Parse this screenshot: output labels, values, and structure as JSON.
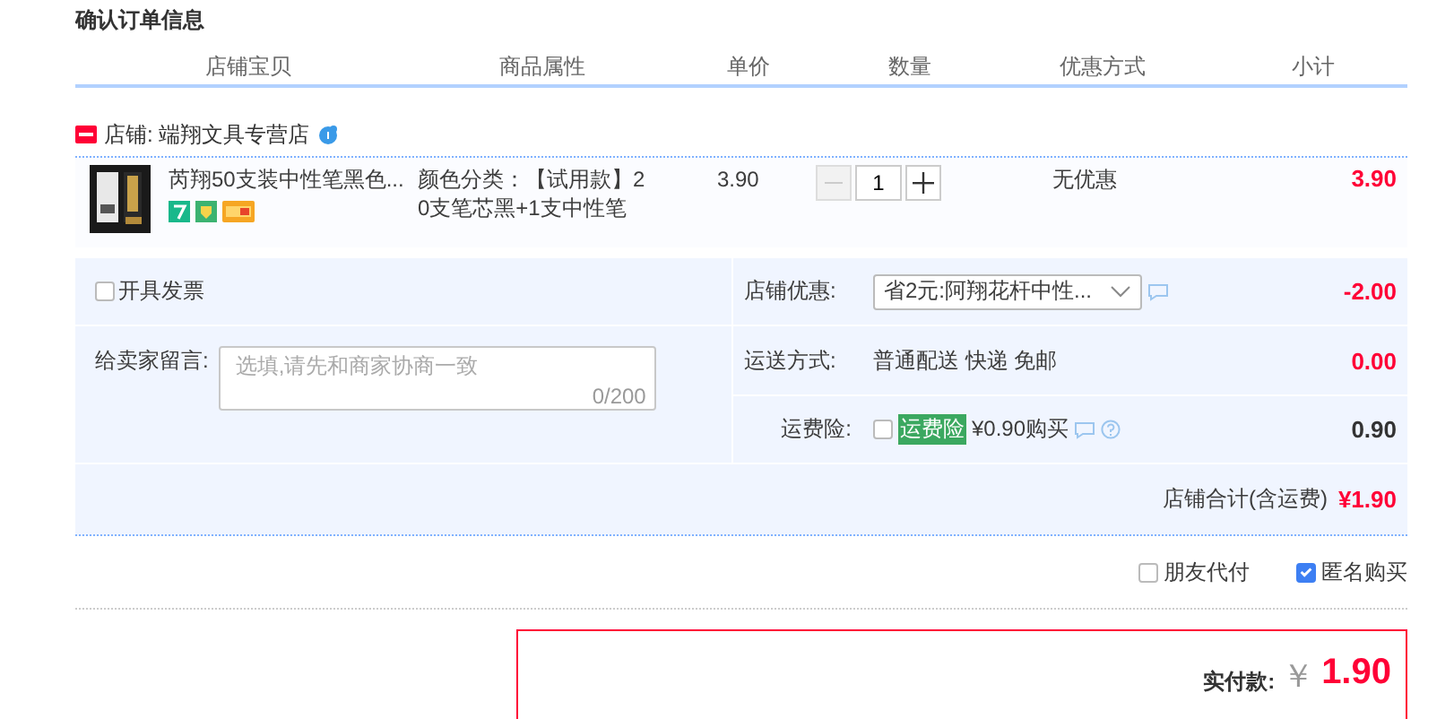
{
  "title": "确认订单信息",
  "columns": [
    "店铺宝贝",
    "商品属性",
    "单价",
    "数量",
    "优惠方式",
    "小计"
  ],
  "shop": {
    "name": "店铺: 端翔文具专营店"
  },
  "items": [
    {
      "name": "芮翔50支装中性笔黑色...",
      "attributes": "颜色分类：【试用款】20支笔芯黑+1支中性笔",
      "price": "3.90",
      "quantity": "1",
      "minus_disabled": true,
      "discount": "无优惠",
      "subtotal": "3.90"
    }
  ],
  "invoice": {
    "label": "开具发票",
    "checked": false
  },
  "message": {
    "label": "给卖家留言:",
    "placeholder": "选填,请先和商家协商一致",
    "counter": "0/200"
  },
  "coupon": {
    "label": "店铺优惠:",
    "value": "省2元:阿翔花杆中性...",
    "amount": "-2.00"
  },
  "shipping": {
    "label": "运送方式:",
    "value": "普通配送 快递 免邮",
    "amount": "0.00"
  },
  "insurance": {
    "label": "运费险:",
    "checked": false,
    "tag": "运费险",
    "price": "¥0.90购买",
    "amount": "0.90"
  },
  "shop_total": {
    "label": "店铺合计(含运费)",
    "value": "¥1.90"
  },
  "options": [
    {
      "label": "朋友代付",
      "checked": false
    },
    {
      "label": "匿名购买",
      "checked": true
    }
  ],
  "payment": {
    "label": "实付款:",
    "currency": "￥",
    "amount": "1.90"
  }
}
